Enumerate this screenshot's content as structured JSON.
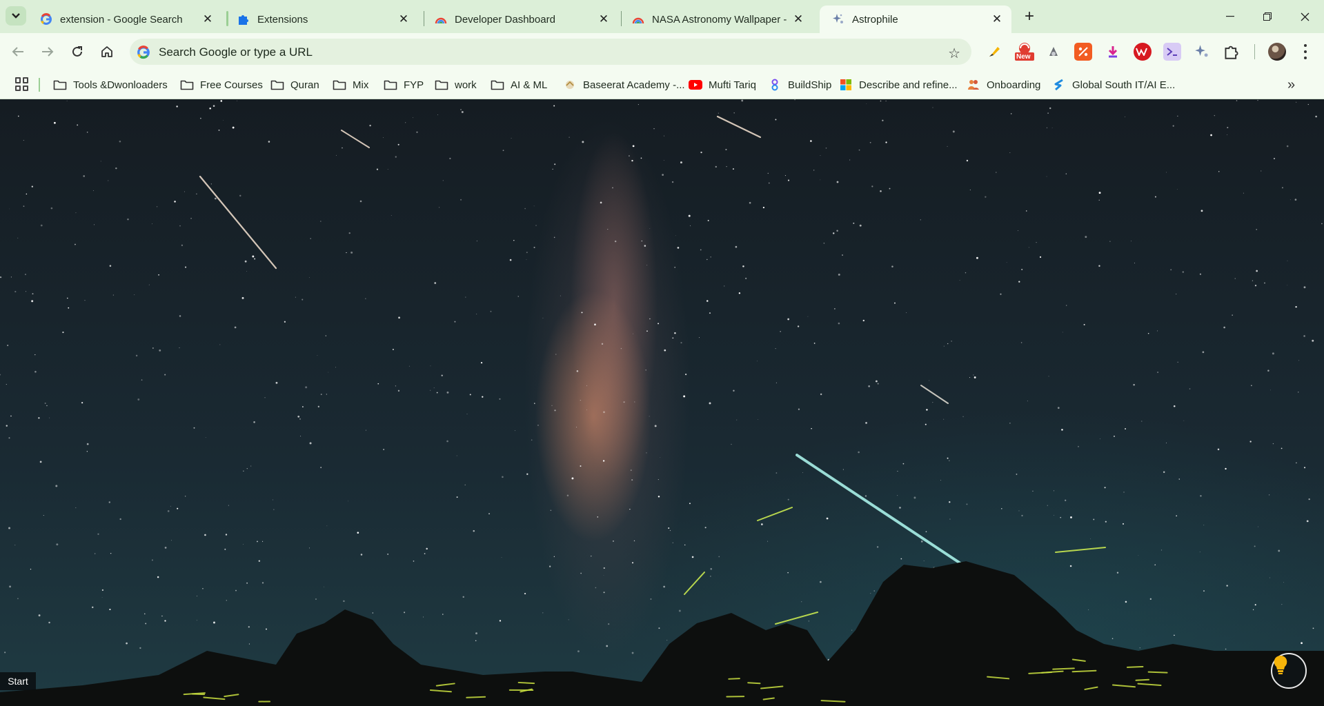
{
  "tabs": [
    {
      "title": "extension - Google Search",
      "icon": "google-icon"
    },
    {
      "title": "Extensions",
      "icon": "puzzle-icon"
    },
    {
      "title": "Developer Dashboard",
      "icon": "rainbow-icon"
    },
    {
      "title": "NASA Astronomy Wallpaper - C",
      "icon": "rainbow-icon"
    },
    {
      "title": "Astrophile",
      "icon": "sparkle-icon",
      "active": true
    }
  ],
  "omnibox": {
    "placeholder": "Search Google or type a URL"
  },
  "extensions": {
    "new_badge": "New"
  },
  "bookmarks": [
    {
      "label": "Tools &Dwonloaders",
      "icon": "folder-icon"
    },
    {
      "label": "Free Courses",
      "icon": "folder-icon"
    },
    {
      "label": "Quran",
      "icon": "folder-icon"
    },
    {
      "label": "Mix",
      "icon": "folder-icon"
    },
    {
      "label": "FYP",
      "icon": "folder-icon"
    },
    {
      "label": "work",
      "icon": "folder-icon"
    },
    {
      "label": "AI & ML",
      "icon": "folder-icon"
    },
    {
      "label": "Baseerat Academy -...",
      "icon": "academy-icon"
    },
    {
      "label": "Mufti Tariq",
      "icon": "youtube-icon"
    },
    {
      "label": "BuildShip",
      "icon": "buildship-icon"
    },
    {
      "label": "Describe and refine...",
      "icon": "microsoft-icon"
    },
    {
      "label": "Onboarding",
      "icon": "people-icon"
    },
    {
      "label": "Global South IT/AI E...",
      "icon": "global-south-icon"
    }
  ],
  "page": {
    "start_label": "Start"
  },
  "colors": {
    "accent": "#dcefd8",
    "toolbar": "#f4fbf1",
    "omnibox": "#e4f1df"
  }
}
